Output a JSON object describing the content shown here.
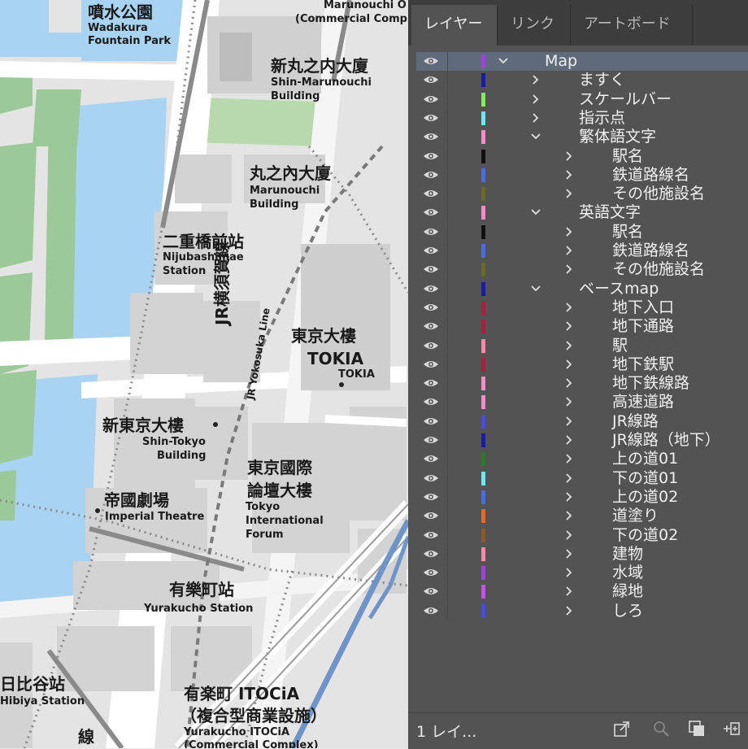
{
  "map": {
    "labels": [
      {
        "id": "wadakura-jp",
        "text": "噴水公園"
      },
      {
        "id": "wadakura-en1",
        "text": "Wadakura"
      },
      {
        "id": "wadakura-en2",
        "text": "Fountain Park"
      },
      {
        "id": "marunouchi-top1",
        "text": "Marunouchi O"
      },
      {
        "id": "marunouchi-top2",
        "text": "(Commercial Comp"
      },
      {
        "id": "shinmaru-jp",
        "text": "新丸之内大廈"
      },
      {
        "id": "shinmaru-en1",
        "text": "Shin-Marunouchi"
      },
      {
        "id": "shinmaru-en2",
        "text": "Building"
      },
      {
        "id": "maru-jp",
        "text": "丸之內大廈"
      },
      {
        "id": "maru-en1",
        "text": "Marunouchi"
      },
      {
        "id": "maru-en2",
        "text": "Building"
      },
      {
        "id": "niju-jp",
        "text": "二重橋前站"
      },
      {
        "id": "niju-en1",
        "text": "Nijubashimae"
      },
      {
        "id": "niju-en2",
        "text": "Station"
      },
      {
        "id": "tokia-jp",
        "text": "東京大樓"
      },
      {
        "id": "tokia-jp2",
        "text": "TOKIA"
      },
      {
        "id": "tokia-en",
        "text": "TOKIA"
      },
      {
        "id": "shintokyo-jp",
        "text": "新東京大樓"
      },
      {
        "id": "shintokyo-en1",
        "text": "Shin-Tokyo"
      },
      {
        "id": "shintokyo-en2",
        "text": "Building"
      },
      {
        "id": "forum-jp1",
        "text": "東京國際"
      },
      {
        "id": "forum-jp2",
        "text": "論壇大樓"
      },
      {
        "id": "forum-en1",
        "text": "Tokyo"
      },
      {
        "id": "forum-en2",
        "text": "International"
      },
      {
        "id": "forum-en3",
        "text": "Forum"
      },
      {
        "id": "imperial-jp",
        "text": "帝國劇場"
      },
      {
        "id": "imperial-en",
        "text": "Imperial Theatre"
      },
      {
        "id": "yurakucho-jp",
        "text": "有樂町站"
      },
      {
        "id": "yurakucho-en",
        "text": "Yurakucho Station"
      },
      {
        "id": "hibiya-jp",
        "text": "日比谷站"
      },
      {
        "id": "hibiya-en",
        "text": "Hibiya Station"
      },
      {
        "id": "itocia-jp1",
        "text": "有楽町 ITOCiA"
      },
      {
        "id": "itocia-jp2",
        "text": "（複合型商業設施）"
      },
      {
        "id": "itocia-en1",
        "text": "Yurakucho ITOCiA"
      },
      {
        "id": "itocia-en2",
        "text": "(Commercial Complex)"
      }
    ],
    "line_label_jp": "JR横須賀線",
    "line_label_en": "JR Yokosuka Line",
    "line_label_bottom": "線"
  },
  "panel": {
    "tabs": [
      "レイヤー",
      "リンク",
      "アートボード"
    ],
    "active_tab": "レイヤー",
    "layers": [
      {
        "name": "Map",
        "color": "#a040e0",
        "level": 0,
        "expanded": true,
        "selected": true
      },
      {
        "name": "ますく",
        "color": "#1a1aa8",
        "level": 1,
        "expanded": false
      },
      {
        "name": "スケールバー",
        "color": "#7ef05a",
        "level": 1,
        "expanded": false
      },
      {
        "name": "指示点",
        "color": "#6fe6f0",
        "level": 1,
        "expanded": false
      },
      {
        "name": "繁体語文字",
        "color": "#f08cc8",
        "level": 1,
        "expanded": true
      },
      {
        "name": "駅名",
        "color": "#111111",
        "level": 2,
        "expanded": false
      },
      {
        "name": "鉄道路線名",
        "color": "#4a6ae8",
        "level": 2,
        "expanded": false
      },
      {
        "name": "その他施設名",
        "color": "#6a6a28",
        "level": 2,
        "expanded": false
      },
      {
        "name": "英語文字",
        "color": "#f08cc8",
        "level": 1,
        "expanded": true
      },
      {
        "name": "駅名",
        "color": "#111111",
        "level": 2,
        "expanded": false
      },
      {
        "name": "鉄道路線名",
        "color": "#4a6ae8",
        "level": 2,
        "expanded": false
      },
      {
        "name": "その他施設名",
        "color": "#6a6a28",
        "level": 2,
        "expanded": false
      },
      {
        "name": "ベースmap",
        "color": "#1a1aa8",
        "level": 1,
        "expanded": true
      },
      {
        "name": "地下入口",
        "color": "#a82040",
        "level": 2,
        "expanded": false
      },
      {
        "name": "地下通路",
        "color": "#a82040",
        "level": 2,
        "expanded": false
      },
      {
        "name": "駅",
        "color": "#f08ca8",
        "level": 2,
        "expanded": false
      },
      {
        "name": "地下鉄駅",
        "color": "#a82040",
        "level": 2,
        "expanded": false
      },
      {
        "name": "地下鉄線路",
        "color": "#f08cc8",
        "level": 2,
        "expanded": false
      },
      {
        "name": "高速道路",
        "color": "#f08cc8",
        "level": 2,
        "expanded": false
      },
      {
        "name": "JR線路",
        "color": "#4a4ae8",
        "level": 2,
        "expanded": false
      },
      {
        "name": "JR線路（地下）",
        "color": "#1a1aa8",
        "level": 2,
        "expanded": false
      },
      {
        "name": "上の道01",
        "color": "#2a7a2a",
        "level": 2,
        "expanded": false
      },
      {
        "name": "下の道01",
        "color": "#6fe6f0",
        "level": 2,
        "expanded": false
      },
      {
        "name": "上の道02",
        "color": "#4a6ae8",
        "level": 2,
        "expanded": false
      },
      {
        "name": "道塗り",
        "color": "#e86a28",
        "level": 2,
        "expanded": false
      },
      {
        "name": "下の道02",
        "color": "#8a5a28",
        "level": 2,
        "expanded": false
      },
      {
        "name": "建物",
        "color": "#f08ca8",
        "level": 2,
        "expanded": false
      },
      {
        "name": "水域",
        "color": "#a040e0",
        "level": 2,
        "expanded": false
      },
      {
        "name": "緑地",
        "color": "#c850f0",
        "level": 2,
        "expanded": false
      },
      {
        "name": "しろ",
        "color": "#4a4ae8",
        "level": 2,
        "expanded": false
      }
    ],
    "footer_label": "1 レイ..."
  }
}
